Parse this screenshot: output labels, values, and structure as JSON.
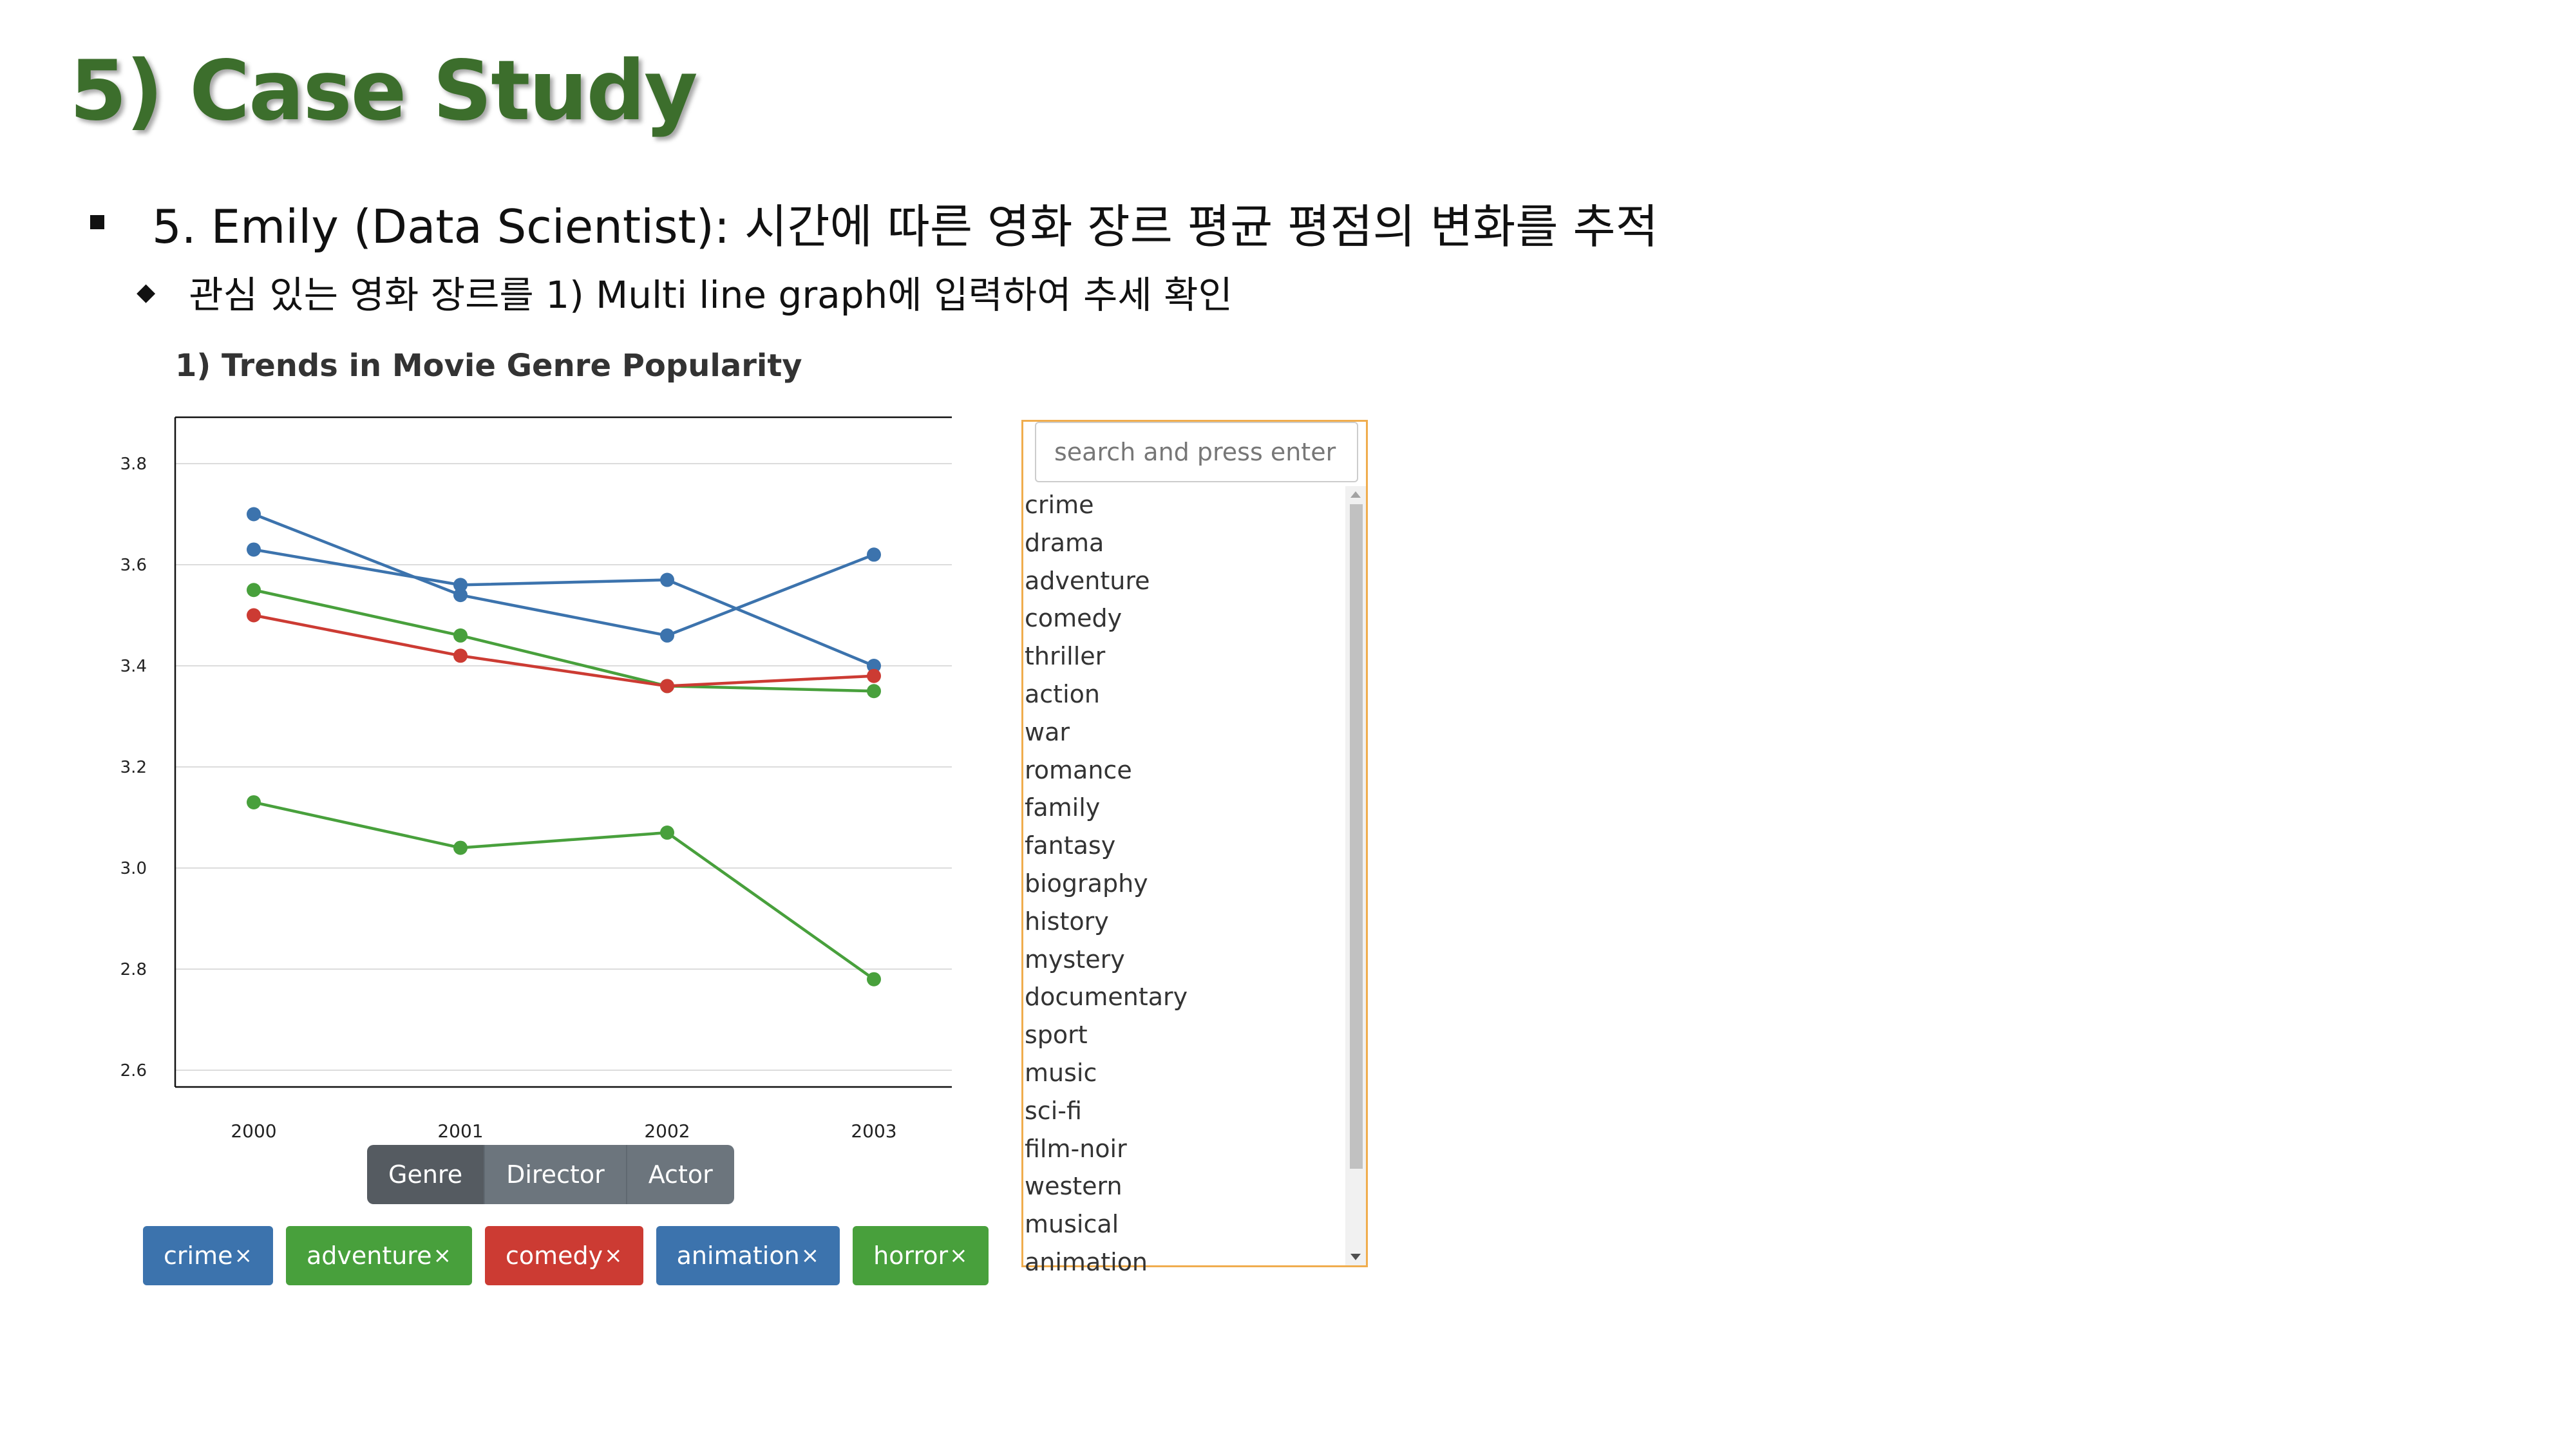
{
  "slide": {
    "title": "5) Case Study",
    "bullet1": "5. Emily (Data Scientist): 시간에 따른 영화 장르 평균 평점의 변화를 추적",
    "bullet2": "관심 있는 영화 장르를 1) Multi line graph에 입력하여 추세 확인"
  },
  "chart_data": {
    "type": "line",
    "title": "1) Trends in Movie Genre Popularity",
    "x": [
      "2000",
      "2001",
      "2002",
      "2003"
    ],
    "ylim": [
      2.6,
      3.8
    ],
    "yticks": [
      "3.8",
      "3.6",
      "3.4",
      "3.2",
      "3.0",
      "2.8",
      "2.6"
    ],
    "grid": true,
    "series": [
      {
        "color": "#3c73ad",
        "values": [
          3.7,
          3.54,
          3.46,
          3.62
        ]
      },
      {
        "color": "#3c73ad",
        "values": [
          3.63,
          3.56,
          3.57,
          3.4
        ]
      },
      {
        "color": "#48a03c",
        "values": [
          3.55,
          3.46,
          3.36,
          3.35
        ]
      },
      {
        "color": "#cc3b33",
        "values": [
          3.5,
          3.42,
          3.36,
          3.38
        ]
      },
      {
        "color": "#48a03c",
        "values": [
          3.13,
          3.04,
          3.07,
          2.78
        ]
      }
    ]
  },
  "toggle": {
    "options": [
      "Genre",
      "Director",
      "Actor"
    ],
    "active": "Genre"
  },
  "selected_tags": [
    {
      "label": "crime",
      "color": "#3c73ad"
    },
    {
      "label": "adventure",
      "color": "#48a03c"
    },
    {
      "label": "comedy",
      "color": "#cc3b33"
    },
    {
      "label": "animation",
      "color": "#3c73ad"
    },
    {
      "label": "horror",
      "color": "#48a03c"
    }
  ],
  "tag_remove_glyph": "×",
  "search": {
    "placeholder": "search and press enter",
    "value": "",
    "items": [
      "crime",
      "drama",
      "adventure",
      "comedy",
      "thriller",
      "action",
      "war",
      "romance",
      "family",
      "fantasy",
      "biography",
      "history",
      "mystery",
      "documentary",
      "sport",
      "music",
      "sci-fi",
      "film-noir",
      "western",
      "musical",
      "animation"
    ]
  }
}
